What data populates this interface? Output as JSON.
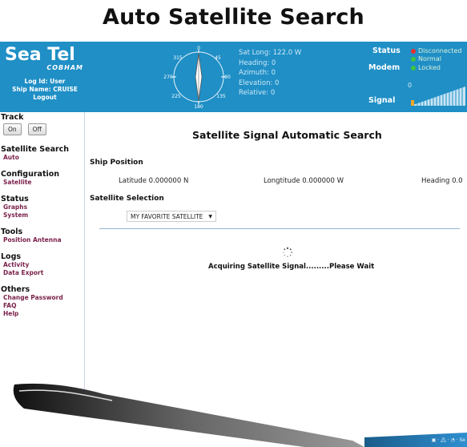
{
  "page_title": "Auto Satellite Search",
  "brand": {
    "name": "Sea Tel",
    "sub": "COBHAM",
    "log_id": "Log Id: User",
    "ship_name": "Ship Name: CRUISE",
    "logout": "Logout"
  },
  "compass": {
    "ticks": [
      "0",
      "45",
      "90",
      "135",
      "180",
      "225",
      "270",
      "315"
    ]
  },
  "readouts": {
    "sat_long": "Sat Long: 122.0 W",
    "heading": "Heading: 0",
    "azimuth": "Azimuth: 0",
    "elevation": "Elevation: 0",
    "relative": "Relative: 0"
  },
  "status": {
    "status_label": "Status",
    "modem_label": "Modem",
    "signal_label": "Signal",
    "disconnected": "Disconnected",
    "normal": "Normal",
    "locked": "Locked",
    "signal_value": "0",
    "colors": {
      "disconnected": "#e53030",
      "normal": "#3ec43e",
      "locked": "#3ec43e"
    }
  },
  "sidebar": {
    "track": {
      "heading": "Track",
      "on": "On",
      "off": "Off"
    },
    "sections": [
      {
        "heading": "Satellite Search",
        "links": [
          "Auto"
        ]
      },
      {
        "heading": "Configuration",
        "links": [
          "Satellite"
        ]
      },
      {
        "heading": "Status",
        "links": [
          "Graphs",
          "System"
        ]
      },
      {
        "heading": "Tools",
        "links": [
          "Position Antenna"
        ]
      },
      {
        "heading": "Logs",
        "links": [
          "Activity",
          "Data Export"
        ]
      },
      {
        "heading": "Others",
        "links": [
          "Change Password",
          "FAQ",
          "Help"
        ]
      }
    ]
  },
  "main": {
    "title": "Satellite Signal Automatic Search",
    "ship_position": "Ship Position",
    "latitude": "Latitude 0.000000 N",
    "longitude": "Longtitude 0.000000 W",
    "heading": "Heading 0.0",
    "satellite_selection": "Satellite Selection",
    "selected_satellite": "MY FAVORITE SATELLITE",
    "acquiring": "Acquiring Satellite Signal.........Please Wait"
  },
  "taskbar": {
    "tray": "▣ · 🖧 · ◔ · Se"
  }
}
